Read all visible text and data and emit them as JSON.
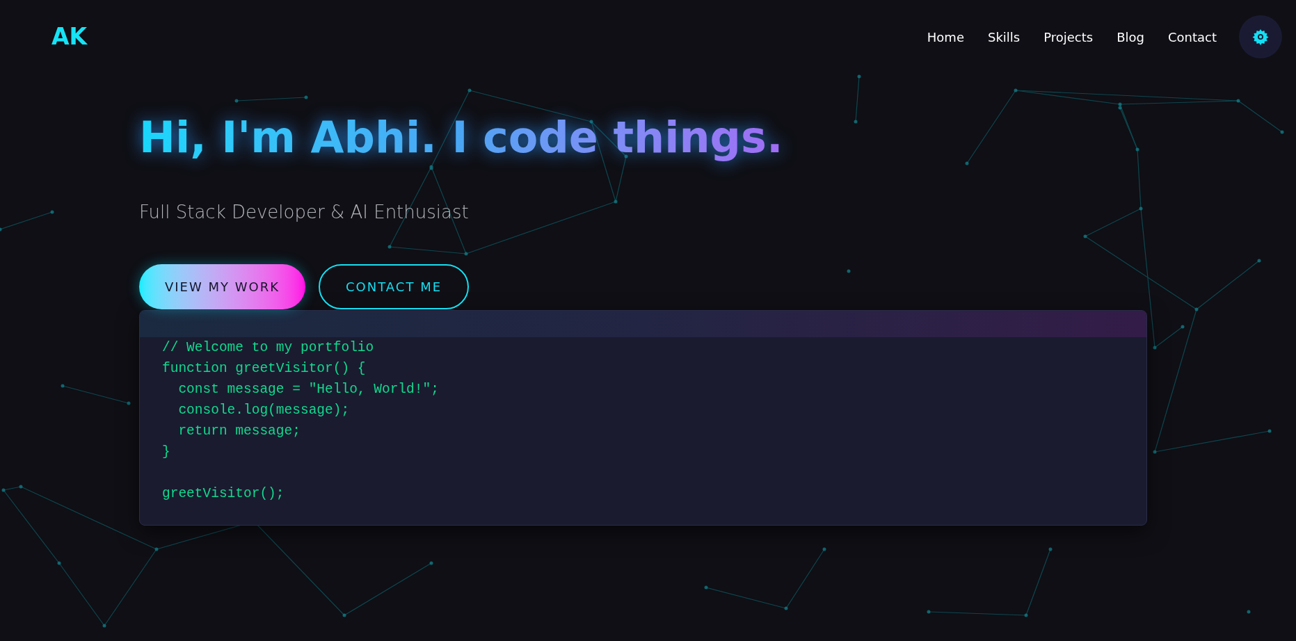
{
  "header": {
    "logo": "AK",
    "nav": [
      {
        "label": "Home"
      },
      {
        "label": "Skills"
      },
      {
        "label": "Projects"
      },
      {
        "label": "Blog"
      },
      {
        "label": "Contact"
      }
    ]
  },
  "hero": {
    "title": "Hi, I'm Abhi. I code things.",
    "subtitle": "Full Stack Developer & AI Enthusiast",
    "buttons": [
      {
        "label": "VIEW MY WORK",
        "kind": "primary"
      },
      {
        "label": "CONTACT ME",
        "kind": "outline"
      }
    ]
  },
  "code_window": {
    "code": "// Welcome to my portfolio\nfunction greetVisitor() {\n  const message = \"Hello, World!\";\n  console.log(message);\n  return message;\n}\n\ngreetVisitor();"
  }
}
